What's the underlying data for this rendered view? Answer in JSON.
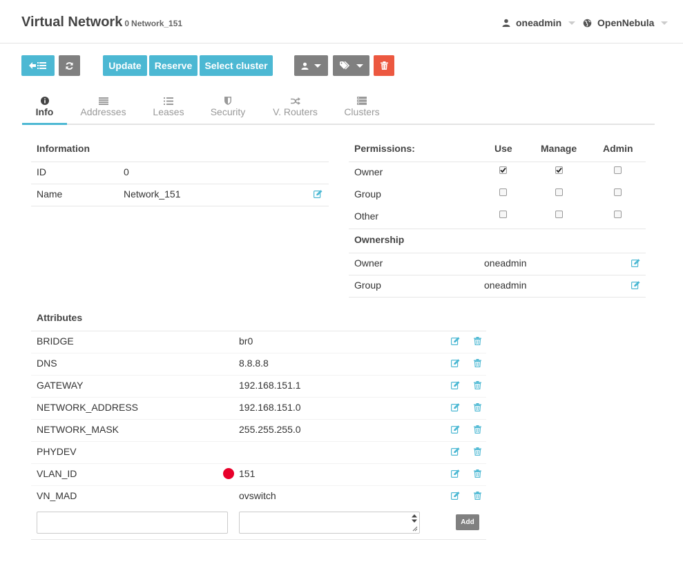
{
  "header": {
    "title": "Virtual Network",
    "id": "0",
    "name": "Network_151",
    "user": "oneadmin",
    "zone": "OpenNebula"
  },
  "toolbar": {
    "update": "Update",
    "reserve": "Reserve",
    "select_cluster": "Select cluster"
  },
  "tabs": [
    {
      "label": "Info",
      "icon": "info-circle-icon"
    },
    {
      "label": "Addresses",
      "icon": "list-icon"
    },
    {
      "label": "Leases",
      "icon": "list-ul-icon"
    },
    {
      "label": "Security",
      "icon": "shield-icon"
    },
    {
      "label": "V. Routers",
      "icon": "random-icon"
    },
    {
      "label": "Clusters",
      "icon": "server-icon"
    }
  ],
  "information": {
    "title": "Information",
    "rows": [
      {
        "label": "ID",
        "value": "0"
      },
      {
        "label": "Name",
        "value": "Network_151"
      }
    ]
  },
  "permissions": {
    "title": "Permissions:",
    "columns": [
      "Use",
      "Manage",
      "Admin"
    ],
    "rows": [
      {
        "label": "Owner",
        "values": [
          true,
          true,
          false
        ]
      },
      {
        "label": "Group",
        "values": [
          false,
          false,
          false
        ]
      },
      {
        "label": "Other",
        "values": [
          false,
          false,
          false
        ]
      }
    ]
  },
  "ownership": {
    "title": "Ownership",
    "rows": [
      {
        "label": "Owner",
        "value": "oneadmin"
      },
      {
        "label": "Group",
        "value": "oneadmin"
      }
    ]
  },
  "attributes": {
    "title": "Attributes",
    "rows": [
      {
        "key": "BRIDGE",
        "value": "br0"
      },
      {
        "key": "DNS",
        "value": "8.8.8.8"
      },
      {
        "key": "GATEWAY",
        "value": "192.168.151.1"
      },
      {
        "key": "NETWORK_ADDRESS",
        "value": "192.168.151.0"
      },
      {
        "key": "NETWORK_MASK",
        "value": "255.255.255.0"
      },
      {
        "key": "PHYDEV",
        "value": ""
      },
      {
        "key": "VLAN_ID",
        "value": "151"
      },
      {
        "key": "VN_MAD",
        "value": "ovswitch"
      }
    ],
    "add_label": "Add"
  },
  "colors": {
    "accent": "#4cb8d3",
    "gray": "#808080",
    "danger": "#ec5840",
    "vlan_marker": "#e8002a"
  }
}
